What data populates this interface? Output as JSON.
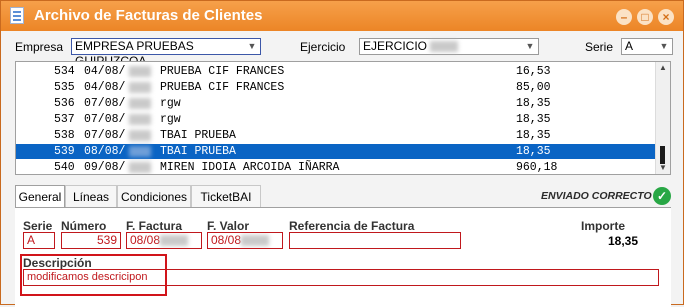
{
  "window": {
    "title": "Archivo de Facturas de Clientes"
  },
  "filters": {
    "empresa_label": "Empresa",
    "empresa_value": "EMPRESA PRUEBAS GUIPUZCOA",
    "ejercicio_label": "Ejercicio",
    "ejercicio_value": "EJERCICIO",
    "serie_label": "Serie",
    "serie_value": "A"
  },
  "invoices": [
    {
      "num": "534",
      "date": "04/08/",
      "name": "PRUEBA CIF FRANCES",
      "amount": "16,53"
    },
    {
      "num": "535",
      "date": "04/08/",
      "name": "PRUEBA CIF FRANCES",
      "amount": "85,00"
    },
    {
      "num": "536",
      "date": "07/08/",
      "name": "rgw",
      "amount": "18,35"
    },
    {
      "num": "537",
      "date": "07/08/",
      "name": "rgw",
      "amount": "18,35"
    },
    {
      "num": "538",
      "date": "07/08/",
      "name": "TBAI PRUEBA",
      "amount": "18,35"
    },
    {
      "num": "539",
      "date": "08/08/",
      "name": "TBAI PRUEBA",
      "amount": "18,35"
    },
    {
      "num": "540",
      "date": "09/08/",
      "name": "MIREN IDOIA ARCOIDA IÑARRA",
      "amount": "960,18"
    }
  ],
  "tabs": [
    "General",
    "Líneas",
    "Condiciones",
    "TicketBAI"
  ],
  "status": {
    "text": "ENVIADO CORRECTO"
  },
  "form": {
    "serie_label": "Serie",
    "serie_value": "A",
    "numero_label": "Número",
    "numero_value": "539",
    "ffactura_label": "F. Factura",
    "ffactura_value": "08/08",
    "fvalor_label": "F. Valor",
    "fvalor_value": "08/08",
    "referencia_label": "Referencia de Factura",
    "referencia_value": "",
    "importe_label": "Importe",
    "importe_value": "18,35",
    "descripcion_label": "Descripción",
    "descripcion_value": "modificamos descricipon"
  },
  "colors": {
    "titlebar": "#ec8526",
    "selection": "#0a64c4",
    "required": "#c0181d",
    "status_ok": "#28a745"
  }
}
